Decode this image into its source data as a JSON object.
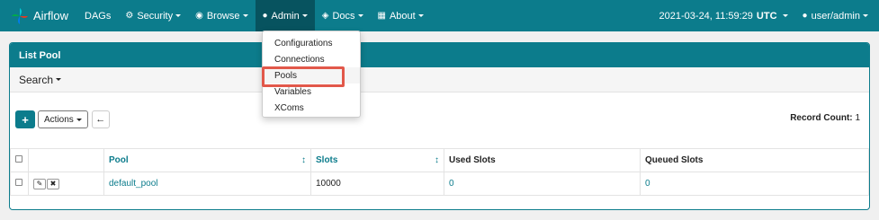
{
  "navbar": {
    "brand": "Airflow",
    "items": [
      {
        "label": "DAGs",
        "icon": "none"
      },
      {
        "label": "Security",
        "icon": "cogs-icon"
      },
      {
        "label": "Browse",
        "icon": "globe-icon"
      },
      {
        "label": "Admin",
        "icon": "user-icon"
      },
      {
        "label": "Docs",
        "icon": "cube-icon"
      },
      {
        "label": "About",
        "icon": "grid-icon"
      }
    ],
    "datetime": "2021-03-24, 11:59:29",
    "timezone": "UTC",
    "user": "user/admin"
  },
  "admin_menu": [
    "Configurations",
    "Connections",
    "Pools",
    "Variables",
    "XComs"
  ],
  "panel": {
    "title": "List Pool",
    "search_label": "Search",
    "actions_label": "Actions",
    "record_count_label": "Record Count:",
    "record_count": "1"
  },
  "table": {
    "headers": [
      "Pool",
      "Slots",
      "Used Slots",
      "Queued Slots"
    ],
    "rows": [
      {
        "pool": "default_pool",
        "slots": "10000",
        "used_slots": "0",
        "queued_slots": "0"
      }
    ]
  },
  "colors": {
    "brand": "#0c7c8c",
    "highlight": "#e2584a"
  }
}
